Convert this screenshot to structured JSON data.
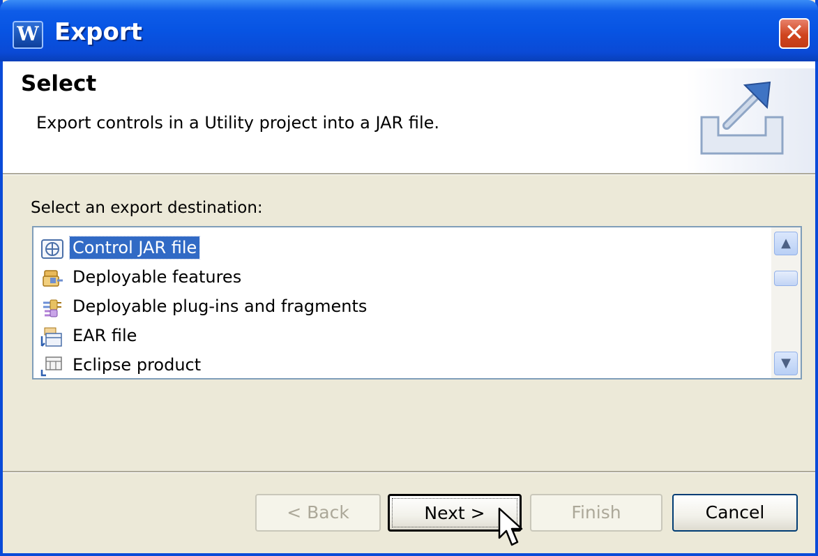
{
  "window": {
    "title": "Export",
    "app_icon_letter": "W",
    "close_glyph": "✕"
  },
  "header": {
    "title": "Select",
    "description": "Export controls in a Utility project into a JAR file.",
    "graphic": "export-wizard-graphic"
  },
  "body": {
    "prompt": "Select an export destination:",
    "items": [
      {
        "label": "Control JAR file",
        "icon": "control-jar-icon",
        "selected": true
      },
      {
        "label": "Deployable features",
        "icon": "features-icon",
        "selected": false
      },
      {
        "label": "Deployable plug-ins and fragments",
        "icon": "plugins-icon",
        "selected": false
      },
      {
        "label": "EAR file",
        "icon": "ear-file-icon",
        "selected": false
      },
      {
        "label": "Eclipse product",
        "icon": "eclipse-product-icon",
        "selected": false
      }
    ]
  },
  "buttons": {
    "back": "< Back",
    "next": "Next >",
    "finish": "Finish",
    "cancel": "Cancel"
  },
  "colors": {
    "titlebar": "#0754e3",
    "selection": "#316ac5",
    "dialog_bg": "#ece9d8"
  }
}
